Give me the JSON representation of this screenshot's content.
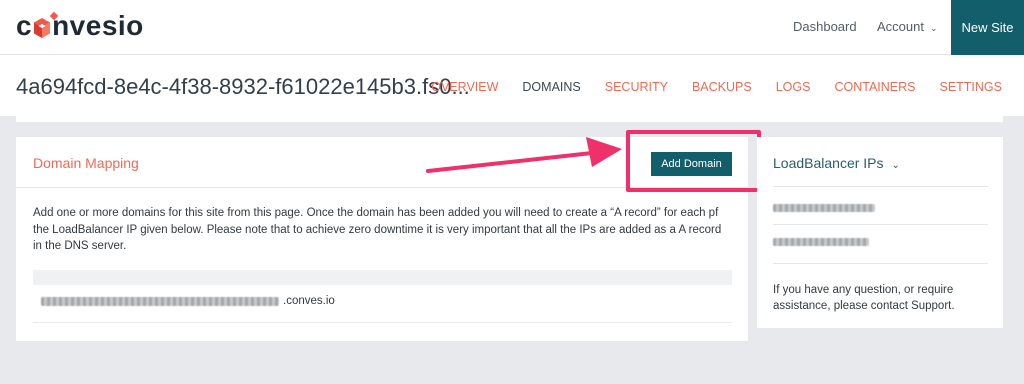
{
  "brand": {
    "logo_prefix": "c",
    "logo_suffix": "nvesio"
  },
  "navbar": {
    "dashboard": "Dashboard",
    "account": "Account",
    "new_site": "New Site"
  },
  "page": {
    "title": "4a694fcd-8e4c-4f38-8932-f61022e145b3.fs0..."
  },
  "tabs": [
    {
      "label": "OVERVIEW",
      "active": false
    },
    {
      "label": "DOMAINS",
      "active": true
    },
    {
      "label": "SECURITY",
      "active": false
    },
    {
      "label": "BACKUPS",
      "active": false
    },
    {
      "label": "LOGS",
      "active": false
    },
    {
      "label": "CONTAINERS",
      "active": false
    },
    {
      "label": "SETTINGS",
      "active": false
    }
  ],
  "domain_mapping": {
    "title": "Domain Mapping",
    "add_button": "Add Domain",
    "description": "Add one or more domains for this site from this page. Once the domain has been added you will need to create a “A record” for each pf the LoadBalancer IP given below. Please note that to achieve zero downtime it is very important that all the IPs are added as a A record in the DNS server.",
    "domain_suffix": ".conves.io"
  },
  "loadbalancer": {
    "title": "LoadBalancer IPs",
    "help": "If you have any question, or require assistance, please contact Support."
  },
  "colors": {
    "brand_teal": "#135e6b",
    "accent_orange": "#ee6a55",
    "highlight_pink": "#f0306a",
    "background_gray": "#e7e9ec"
  }
}
